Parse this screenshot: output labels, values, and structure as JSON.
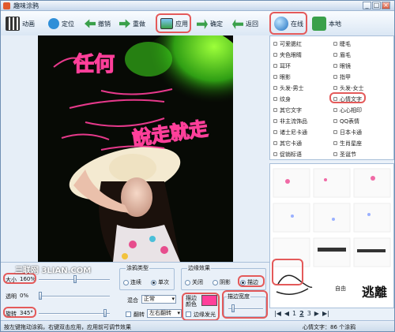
{
  "window": {
    "title": "趣味涂鸦"
  },
  "toolbar": {
    "items": [
      {
        "label": "动画"
      },
      {
        "label": "定位"
      },
      {
        "label": "撤销"
      },
      {
        "label": "重做"
      },
      {
        "label": "应用"
      },
      {
        "label": "确定"
      },
      {
        "label": "返回"
      },
      {
        "label": "在线"
      },
      {
        "label": "本地"
      }
    ]
  },
  "categories": {
    "left": [
      "可爱腮红",
      "夹色眼睛",
      "耳环",
      "眼影",
      "头发-男士",
      "纹身",
      "其它文字",
      "非主流饰品",
      "诸士尼卡通",
      "其它卡通",
      "促销标语"
    ],
    "right": [
      "睫毛",
      "眉毛",
      "眼镜",
      "指甲",
      "头发-女士",
      "心情文字",
      "心心相印",
      "QQ表情",
      "日本卡通",
      "生肖星座",
      "圣诞节"
    ],
    "selected": "心情文字"
  },
  "artwork": {
    "texts": [
      "任何",
      "說走就走",
      "逃離"
    ],
    "thumb_texts": [
      "自由",
      "逃離"
    ]
  },
  "controls": {
    "size": {
      "label": "大小",
      "value": "160%"
    },
    "opacity": {
      "label": "透明",
      "value": "0%"
    },
    "rotate": {
      "label": "旋转",
      "value": "345°"
    },
    "paint_type": {
      "title": "涂鸦类型",
      "options": [
        "连续",
        "单次"
      ],
      "selected": "单次"
    },
    "blend": {
      "label": "混合",
      "value": "正常"
    },
    "flip": {
      "label": "翻转",
      "value": "左右翻转"
    },
    "edge_effect": {
      "title": "边缘效果",
      "options": [
        "关闭",
        "阴影",
        "描边"
      ],
      "selected": "描边"
    },
    "stroke_color": {
      "label": "描边颜色",
      "value": "#ff3f9a"
    },
    "stroke_width": {
      "label": "描边宽度"
    },
    "edge_glow": {
      "label": "边缘发光"
    }
  },
  "pager": {
    "prev_all": "|◀",
    "prev": "◀",
    "pages": [
      "1",
      "2",
      "3"
    ],
    "current": "2",
    "next": "▶",
    "next_all": "▶|"
  },
  "status": {
    "left": "按左键拖动涂鸦，右键双击应用，应用前可调节效果",
    "right": "心情文字：86 个涂鸦"
  },
  "watermark": "三联网 3LIAN.COM",
  "colors": {
    "stroke": "#ff3f9a",
    "highlight": "#e45a5a"
  }
}
